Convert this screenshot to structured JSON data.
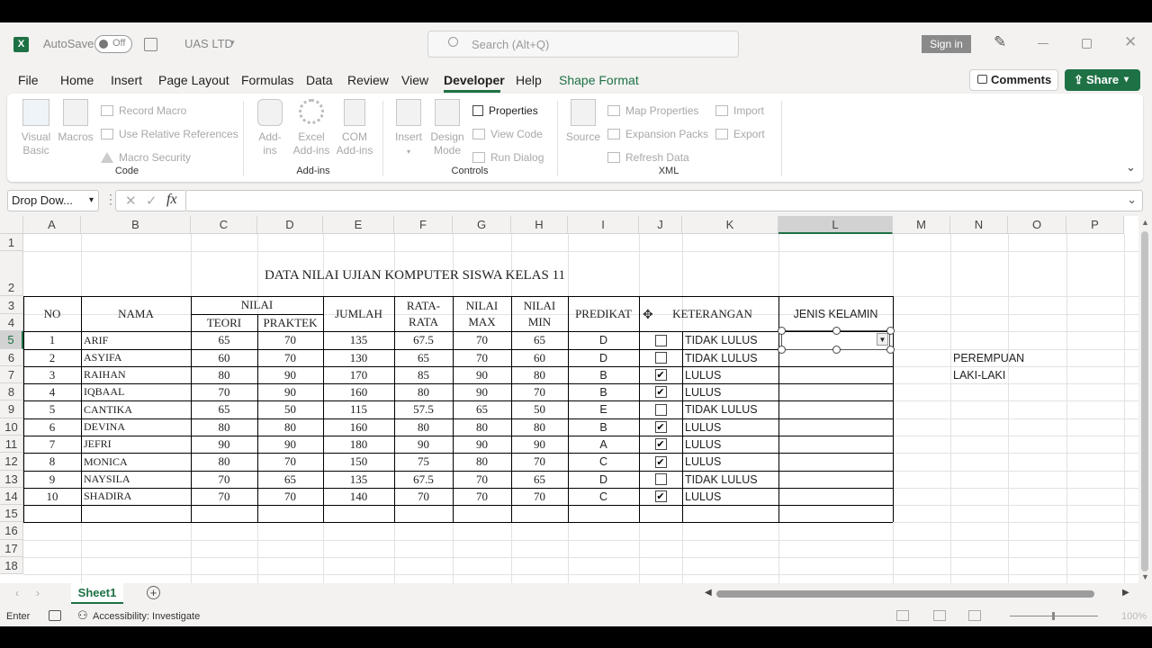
{
  "titlebar": {
    "autosave": "AutoSave",
    "autosave_state": "Off",
    "filename": "UAS LTD",
    "search_placeholder": "Search (Alt+Q)",
    "sign_in": "Sign in"
  },
  "menu": [
    "File",
    "Home",
    "Insert",
    "Page Layout",
    "Formulas",
    "Data",
    "Review",
    "View",
    "Developer",
    "Help",
    "Shape Format"
  ],
  "active_tab": "Developer",
  "buttons": {
    "comments": "Comments",
    "share": "Share"
  },
  "ribbon": {
    "code": {
      "visual_basic": "Visual Basic",
      "macros": "Macros",
      "record": "Record Macro",
      "relative": "Use Relative References",
      "security": "Macro Security",
      "label": "Code"
    },
    "addins": {
      "addins": "Add-ins",
      "excel": "Excel Add-ins",
      "com": "COM Add-ins",
      "label": "Add-ins"
    },
    "controls": {
      "insert": "Insert",
      "design": "Design Mode",
      "properties": "Properties",
      "view_code": "View Code",
      "run_dialog": "Run Dialog",
      "label": "Controls"
    },
    "xml": {
      "source": "Source",
      "map": "Map Properties",
      "expansion": "Expansion Packs",
      "refresh": "Refresh Data",
      "import": "Import",
      "export": "Export",
      "label": "XML"
    }
  },
  "namebox": "Drop Dow...",
  "formula_icon": "fx",
  "columns": [
    "A",
    "B",
    "C",
    "D",
    "E",
    "F",
    "G",
    "H",
    "I",
    "J",
    "K",
    "L",
    "M",
    "N",
    "O",
    "P"
  ],
  "rows": [
    "1",
    "2",
    "3",
    "4",
    "5",
    "6",
    "7",
    "8",
    "9",
    "10",
    "11",
    "12",
    "13",
    "14",
    "15",
    "16",
    "17",
    "18"
  ],
  "sheet": {
    "title": "DATA NILAI UJIAN KOMPUTER SISWA KELAS 11",
    "headers": {
      "no": "NO",
      "nama": "NAMA",
      "nilai": "NILAI",
      "teori": "TEORI",
      "praktek": "PRAKTEK",
      "jumlah": "JUMLAH",
      "rata1": "RATA-",
      "rata2": "RATA",
      "max1": "NILAI",
      "max2": "MAX",
      "min1": "NILAI",
      "min2": "MIN",
      "predikat": "PREDIKAT",
      "keterangan": "KETERANGAN",
      "jk": "JENIS KELAMIN"
    },
    "data": [
      [
        "1",
        "ARIF",
        "65",
        "70",
        "135",
        "67.5",
        "70",
        "65",
        "D",
        false,
        "TIDAK LULUS"
      ],
      [
        "2",
        "ASYIFA",
        "60",
        "70",
        "130",
        "65",
        "70",
        "60",
        "D",
        false,
        "TIDAK LULUS"
      ],
      [
        "3",
        "RAIHAN",
        "80",
        "90",
        "170",
        "85",
        "90",
        "80",
        "B",
        true,
        "LULUS"
      ],
      [
        "4",
        "IQBAAL",
        "70",
        "90",
        "160",
        "80",
        "90",
        "70",
        "B",
        true,
        "LULUS"
      ],
      [
        "5",
        "CANTIKA",
        "65",
        "50",
        "115",
        "57.5",
        "65",
        "50",
        "E",
        false,
        "TIDAK LULUS"
      ],
      [
        "6",
        "DEVINA",
        "80",
        "80",
        "160",
        "80",
        "80",
        "80",
        "B",
        true,
        "LULUS"
      ],
      [
        "7",
        "JEFRI",
        "90",
        "90",
        "180",
        "90",
        "90",
        "90",
        "A",
        true,
        "LULUS"
      ],
      [
        "8",
        "MONICA",
        "80",
        "70",
        "150",
        "75",
        "80",
        "70",
        "C",
        true,
        "LULUS"
      ],
      [
        "9",
        "NAYSILA",
        "70",
        "65",
        "135",
        "67.5",
        "70",
        "65",
        "D",
        false,
        "TIDAK LULUS"
      ],
      [
        "10",
        "SHADIRA",
        "70",
        "70",
        "140",
        "70",
        "70",
        "70",
        "C",
        true,
        "LULUS"
      ]
    ],
    "list": [
      "PEREMPUAN",
      "LAKI-LAKI"
    ]
  },
  "sheet_tab": "Sheet1",
  "status": {
    "mode": "Enter",
    "accessibility": "Accessibility: Investigate",
    "zoom": "100%"
  }
}
